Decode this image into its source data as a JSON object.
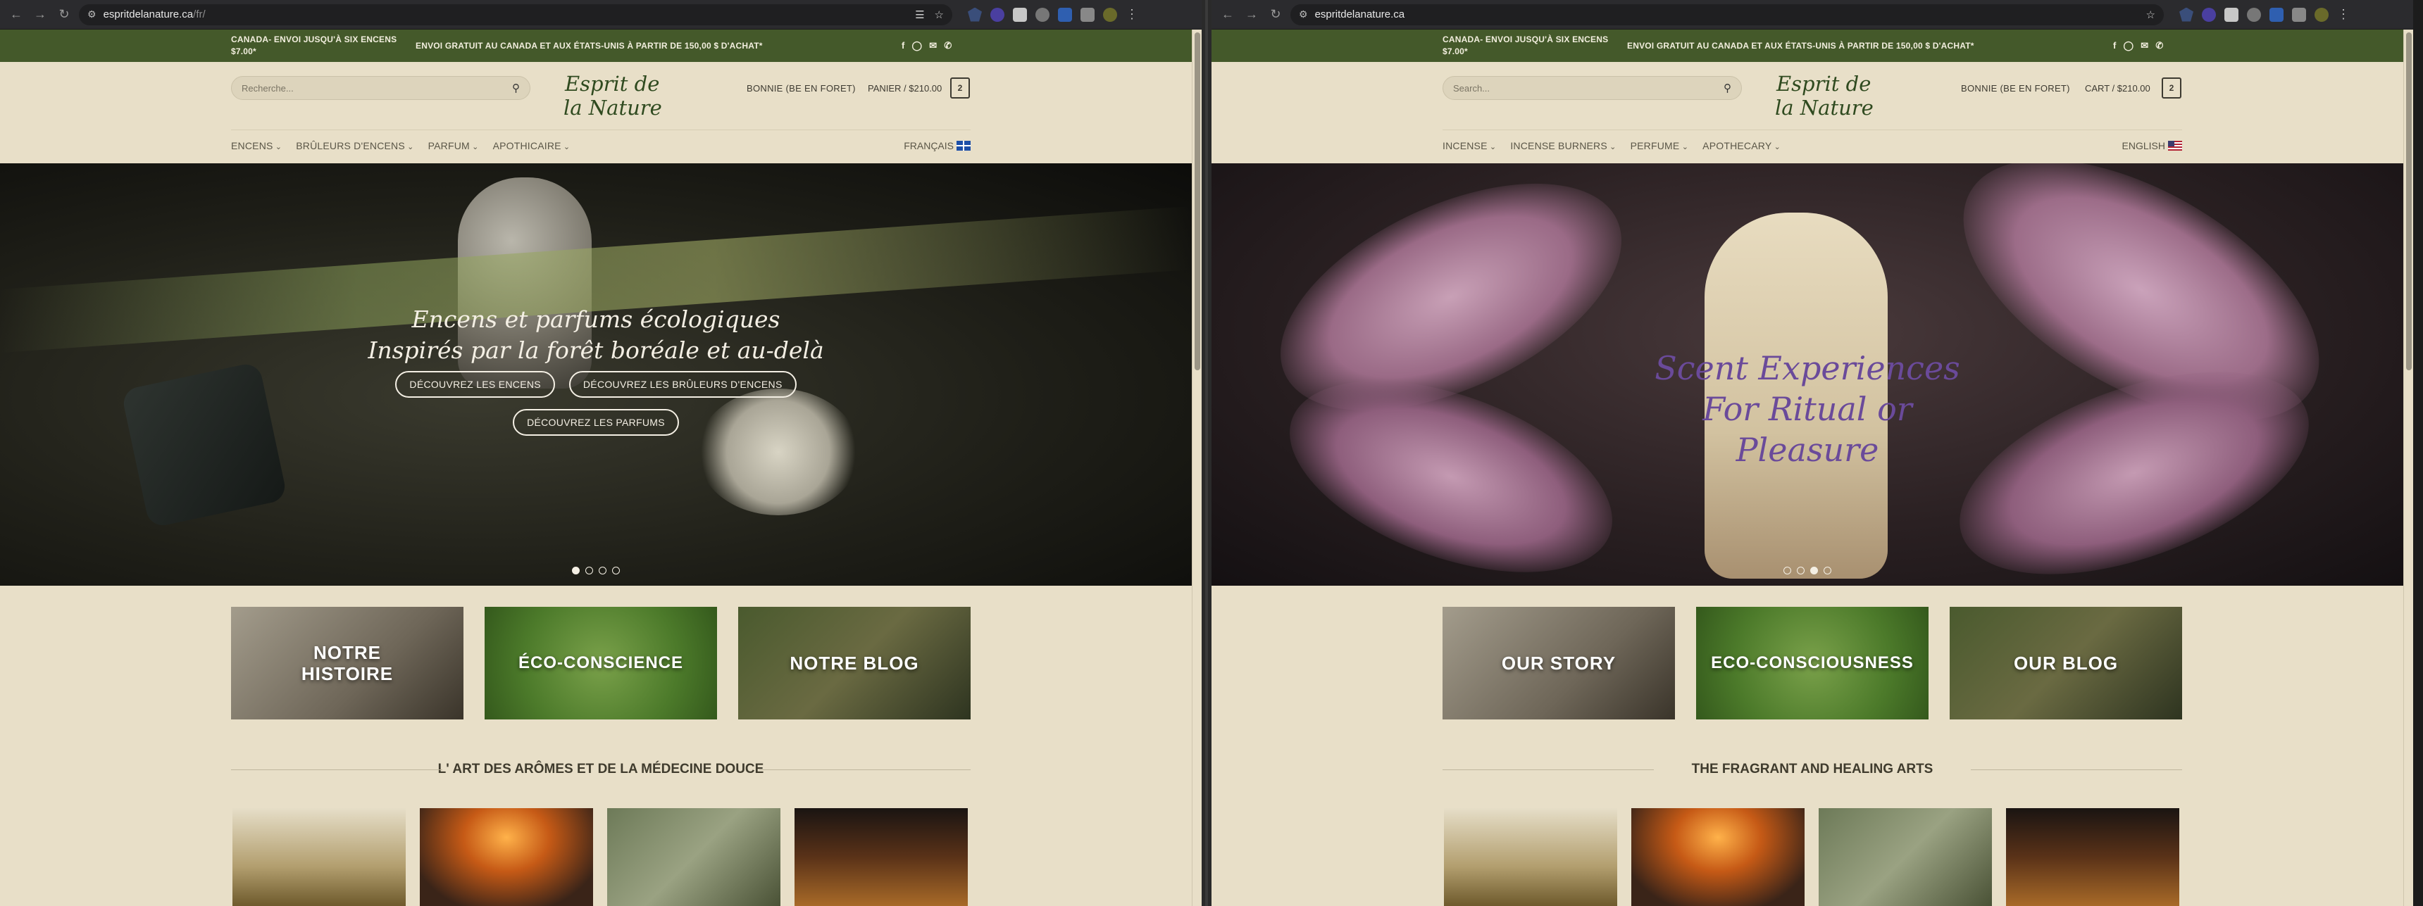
{
  "left": {
    "chrome": {
      "url_host": "espritdelanature.ca",
      "url_path": "/fr/"
    },
    "topbar": {
      "ship_canada_line1": "CANADA- ENVOI JUSQU'À SIX ENCENS",
      "ship_canada_line2": "$7.00*",
      "ship_free": "ENVOI GRATUIT AU CANADA ET AUX ÉTATS-UNIS À PARTIR DE 150,00 $ D'ACHAT*"
    },
    "header": {
      "search_placeholder": "Recherche...",
      "logo_line1": "Esprit de",
      "logo_line2": "la Nature",
      "account": "BONNIE (BE EN FORET)",
      "cart": "PANIER / $210.00",
      "cart_count": "2"
    },
    "nav": {
      "items": [
        "ENCENS",
        "BRÛLEURS D'ENCENS",
        "PARFUM",
        "APOTHICAIRE"
      ],
      "language": "FRANÇAIS"
    },
    "hero": {
      "line1": "Encens et parfums écologiques",
      "line2": "Inspirés par la forêt boréale et au-delà",
      "cta1": "DÉCOUVREZ LES ENCENS",
      "cta2": "DÉCOUVREZ LES BRÛLEURS D'ENCENS",
      "cta3": "DÉCOUVREZ LES PARFUMS",
      "active_slide": 1,
      "slide_count": 4
    },
    "cards": {
      "c1_line1": "NOTRE",
      "c1_line2": "HISTOIRE",
      "c2": "ÉCO-CONSCIENCE",
      "c3": "NOTRE BLOG"
    },
    "section_title": "L' ART DES ARÔMES ET DE LA MÉDECINE DOUCE"
  },
  "right": {
    "chrome": {
      "url_host": "espritdelanature.ca"
    },
    "topbar": {
      "ship_canada_line1": "CANADA- ENVOI JUSQU'À SIX ENCENS",
      "ship_canada_line2": "$7.00*",
      "ship_free": "ENVOI GRATUIT AU CANADA ET AUX ÉTATS-UNIS À PARTIR DE 150,00 $ D'ACHAT*"
    },
    "header": {
      "search_placeholder": "Search...",
      "logo_line1": "Esprit de",
      "logo_line2": "la Nature",
      "account": "BONNIE (BE EN FORET)",
      "cart": "CART / $210.00",
      "cart_count": "2"
    },
    "nav": {
      "items": [
        "INCENSE",
        "INCENSE BURNERS",
        "PERFUME",
        "APOTHECARY"
      ],
      "language": "ENGLISH"
    },
    "hero": {
      "line1": "Scent Experiences",
      "line2": "For Ritual or",
      "line3": "Pleasure",
      "active_slide": 3,
      "slide_count": 4
    },
    "cards": {
      "c1": "OUR STORY",
      "c2": "ECO-CONSCIOUSNESS",
      "c3": "OUR BLOG"
    },
    "section_title": "THE FRAGRANT AND HEALING ARTS"
  },
  "colors": {
    "topbar_green": "#44592a",
    "page_beige": "#e8dfc8",
    "logo_green": "#2f4a1f",
    "hero_en_text": "#6a4a9a"
  }
}
